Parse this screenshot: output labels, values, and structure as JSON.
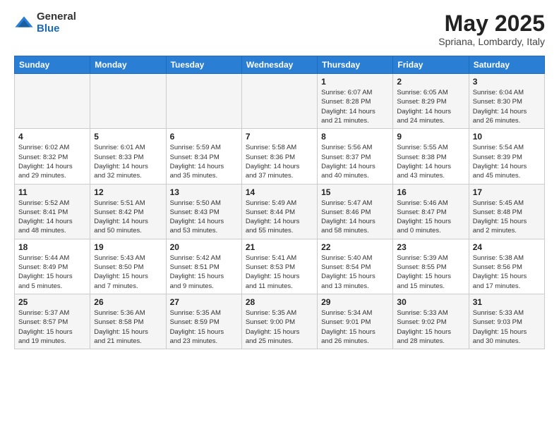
{
  "header": {
    "logo_general": "General",
    "logo_blue": "Blue",
    "month_title": "May 2025",
    "location": "Spriana, Lombardy, Italy"
  },
  "days_of_week": [
    "Sunday",
    "Monday",
    "Tuesday",
    "Wednesday",
    "Thursday",
    "Friday",
    "Saturday"
  ],
  "weeks": [
    [
      {
        "day": "",
        "info": ""
      },
      {
        "day": "",
        "info": ""
      },
      {
        "day": "",
        "info": ""
      },
      {
        "day": "",
        "info": ""
      },
      {
        "day": "1",
        "info": "Sunrise: 6:07 AM\nSunset: 8:28 PM\nDaylight: 14 hours\nand 21 minutes."
      },
      {
        "day": "2",
        "info": "Sunrise: 6:05 AM\nSunset: 8:29 PM\nDaylight: 14 hours\nand 24 minutes."
      },
      {
        "day": "3",
        "info": "Sunrise: 6:04 AM\nSunset: 8:30 PM\nDaylight: 14 hours\nand 26 minutes."
      }
    ],
    [
      {
        "day": "4",
        "info": "Sunrise: 6:02 AM\nSunset: 8:32 PM\nDaylight: 14 hours\nand 29 minutes."
      },
      {
        "day": "5",
        "info": "Sunrise: 6:01 AM\nSunset: 8:33 PM\nDaylight: 14 hours\nand 32 minutes."
      },
      {
        "day": "6",
        "info": "Sunrise: 5:59 AM\nSunset: 8:34 PM\nDaylight: 14 hours\nand 35 minutes."
      },
      {
        "day": "7",
        "info": "Sunrise: 5:58 AM\nSunset: 8:36 PM\nDaylight: 14 hours\nand 37 minutes."
      },
      {
        "day": "8",
        "info": "Sunrise: 5:56 AM\nSunset: 8:37 PM\nDaylight: 14 hours\nand 40 minutes."
      },
      {
        "day": "9",
        "info": "Sunrise: 5:55 AM\nSunset: 8:38 PM\nDaylight: 14 hours\nand 43 minutes."
      },
      {
        "day": "10",
        "info": "Sunrise: 5:54 AM\nSunset: 8:39 PM\nDaylight: 14 hours\nand 45 minutes."
      }
    ],
    [
      {
        "day": "11",
        "info": "Sunrise: 5:52 AM\nSunset: 8:41 PM\nDaylight: 14 hours\nand 48 minutes."
      },
      {
        "day": "12",
        "info": "Sunrise: 5:51 AM\nSunset: 8:42 PM\nDaylight: 14 hours\nand 50 minutes."
      },
      {
        "day": "13",
        "info": "Sunrise: 5:50 AM\nSunset: 8:43 PM\nDaylight: 14 hours\nand 53 minutes."
      },
      {
        "day": "14",
        "info": "Sunrise: 5:49 AM\nSunset: 8:44 PM\nDaylight: 14 hours\nand 55 minutes."
      },
      {
        "day": "15",
        "info": "Sunrise: 5:47 AM\nSunset: 8:46 PM\nDaylight: 14 hours\nand 58 minutes."
      },
      {
        "day": "16",
        "info": "Sunrise: 5:46 AM\nSunset: 8:47 PM\nDaylight: 15 hours\nand 0 minutes."
      },
      {
        "day": "17",
        "info": "Sunrise: 5:45 AM\nSunset: 8:48 PM\nDaylight: 15 hours\nand 2 minutes."
      }
    ],
    [
      {
        "day": "18",
        "info": "Sunrise: 5:44 AM\nSunset: 8:49 PM\nDaylight: 15 hours\nand 5 minutes."
      },
      {
        "day": "19",
        "info": "Sunrise: 5:43 AM\nSunset: 8:50 PM\nDaylight: 15 hours\nand 7 minutes."
      },
      {
        "day": "20",
        "info": "Sunrise: 5:42 AM\nSunset: 8:51 PM\nDaylight: 15 hours\nand 9 minutes."
      },
      {
        "day": "21",
        "info": "Sunrise: 5:41 AM\nSunset: 8:53 PM\nDaylight: 15 hours\nand 11 minutes."
      },
      {
        "day": "22",
        "info": "Sunrise: 5:40 AM\nSunset: 8:54 PM\nDaylight: 15 hours\nand 13 minutes."
      },
      {
        "day": "23",
        "info": "Sunrise: 5:39 AM\nSunset: 8:55 PM\nDaylight: 15 hours\nand 15 minutes."
      },
      {
        "day": "24",
        "info": "Sunrise: 5:38 AM\nSunset: 8:56 PM\nDaylight: 15 hours\nand 17 minutes."
      }
    ],
    [
      {
        "day": "25",
        "info": "Sunrise: 5:37 AM\nSunset: 8:57 PM\nDaylight: 15 hours\nand 19 minutes."
      },
      {
        "day": "26",
        "info": "Sunrise: 5:36 AM\nSunset: 8:58 PM\nDaylight: 15 hours\nand 21 minutes."
      },
      {
        "day": "27",
        "info": "Sunrise: 5:35 AM\nSunset: 8:59 PM\nDaylight: 15 hours\nand 23 minutes."
      },
      {
        "day": "28",
        "info": "Sunrise: 5:35 AM\nSunset: 9:00 PM\nDaylight: 15 hours\nand 25 minutes."
      },
      {
        "day": "29",
        "info": "Sunrise: 5:34 AM\nSunset: 9:01 PM\nDaylight: 15 hours\nand 26 minutes."
      },
      {
        "day": "30",
        "info": "Sunrise: 5:33 AM\nSunset: 9:02 PM\nDaylight: 15 hours\nand 28 minutes."
      },
      {
        "day": "31",
        "info": "Sunrise: 5:33 AM\nSunset: 9:03 PM\nDaylight: 15 hours\nand 30 minutes."
      }
    ]
  ]
}
